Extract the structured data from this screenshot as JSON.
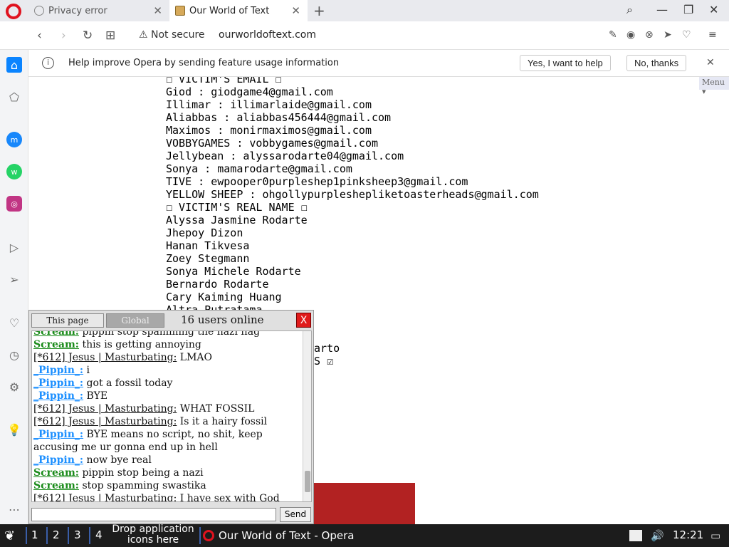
{
  "tabs": [
    {
      "title": "Privacy error",
      "icon": "globe-icon"
    },
    {
      "title": "Our World of Text",
      "icon": "book-icon"
    }
  ],
  "address": {
    "security": "Not secure",
    "url": "ourworldoftext.com"
  },
  "infobar": {
    "text": "Help improve Opera by sending feature usage information",
    "accept": "Yes, I want to help",
    "decline": "No, thanks"
  },
  "page": {
    "menu_label": "Menu",
    "lines": [
      "☐ VICTIM'S EMAIL ☐",
      "Giod : giodgame4@gmail.com",
      "Illimar : illimarlaide@gmail.com",
      "Aliabbas : aliabbas456444@gmail.com",
      "Maximos : monirmaximos@gmail.com",
      "VOBBYGAMES : vobbygames@gmail.com",
      "Jellybean : alyssarodarte04@gmail.com",
      "Sonya : mamarodarte@gmail.com",
      "TIVE : ewpooper0purpleshep1pinksheep3@gmail.com",
      "YELLOW SHEEP : ohgollypurpleshepliketoasterheads@gmail.com",
      "☐ VICTIM'S REAL NAME ☐",
      "Alyssa Jasmine Rodarte",
      "Jhepoy Dizon",
      "Hanan Tikvesa",
      "Zoey Stegmann",
      "Sonya Michele Rodarte",
      "Bernardo Rodarte",
      "Cary Kaiming Huang",
      "Altra Putratama"
    ],
    "partial_lines": [
      "arto",
      "S ☑"
    ]
  },
  "chat": {
    "tab_page": "This page",
    "tab_global": "Global",
    "users_online": "16 users online",
    "close_label": "X",
    "send_label": "Send",
    "messages": [
      {
        "nick": "Scream:",
        "kind": "scream",
        "text": "pippin stop spamming the nazi flag"
      },
      {
        "nick": "Scream:",
        "kind": "scream",
        "text": "this is getting annoying"
      },
      {
        "nick": "[*612] Jesus | Masturbating:",
        "kind": "jesus",
        "text": "LMAO"
      },
      {
        "nick": "_Pippin_:",
        "kind": "pippin",
        "text": "i"
      },
      {
        "nick": "_Pippin_:",
        "kind": "pippin",
        "text": "got a fossil today"
      },
      {
        "nick": "_Pippin_:",
        "kind": "pippin",
        "text": "BYE"
      },
      {
        "nick": "[*612] Jesus | Masturbating:",
        "kind": "jesus",
        "text": "WHAT FOSSIL"
      },
      {
        "nick": "[*612] Jesus | Masturbating:",
        "kind": "jesus",
        "text": "Is it a hairy fossil"
      },
      {
        "nick": "_Pippin_:",
        "kind": "pippin",
        "text": "BYE means no script, no shit, keep accusing me ur gonna end up in hell"
      },
      {
        "nick": "_Pippin_:",
        "kind": "pippin",
        "text": "now bye real"
      },
      {
        "nick": "Scream:",
        "kind": "scream",
        "text": "pippin stop being a nazi"
      },
      {
        "nick": "Scream:",
        "kind": "scream",
        "text": "stop spamming swastika"
      },
      {
        "nick": "[*612] Jesus | Masturbating:",
        "kind": "jesus",
        "text": "I have sex with God"
      }
    ]
  },
  "taskbar": {
    "workspaces": [
      "1",
      "2",
      "3",
      "4"
    ],
    "drop_text_1": "Drop application",
    "drop_text_2": "icons here",
    "window_title": "Our World of Text - Opera",
    "clock": "12:21"
  },
  "colors": {
    "opera_red": "#e0131f",
    "chat_scream": "#1a8b1a",
    "chat_pippin": "#1e90ff",
    "block": "#b22222"
  }
}
